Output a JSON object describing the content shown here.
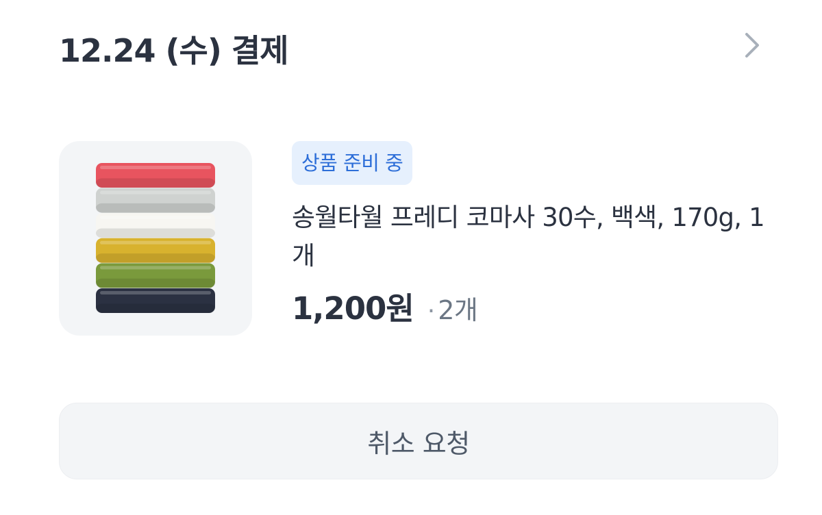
{
  "order": {
    "date_title": "12.24 (수) 결제",
    "detail_icon": "chevron-right-icon"
  },
  "product": {
    "image": "stacked-towels-thumbnail",
    "towel_colors": [
      "#e8545f",
      "#cfd2d0",
      "#f7f6f2",
      "#d8b22e",
      "#7a9a3c",
      "#2b3142"
    ],
    "status": "상품 준비 중",
    "name": "송월타월 프레디 코마사 30수, 백색, 170g, 1개",
    "price": "1,200원",
    "separator": "·",
    "quantity": "2개"
  },
  "actions": {
    "cancel_label": "취소 요청"
  },
  "colors": {
    "badge_bg": "#e6f0fd",
    "badge_text": "#2d6ed8",
    "button_bg": "#f3f5f7",
    "title_text": "#2b3240"
  }
}
